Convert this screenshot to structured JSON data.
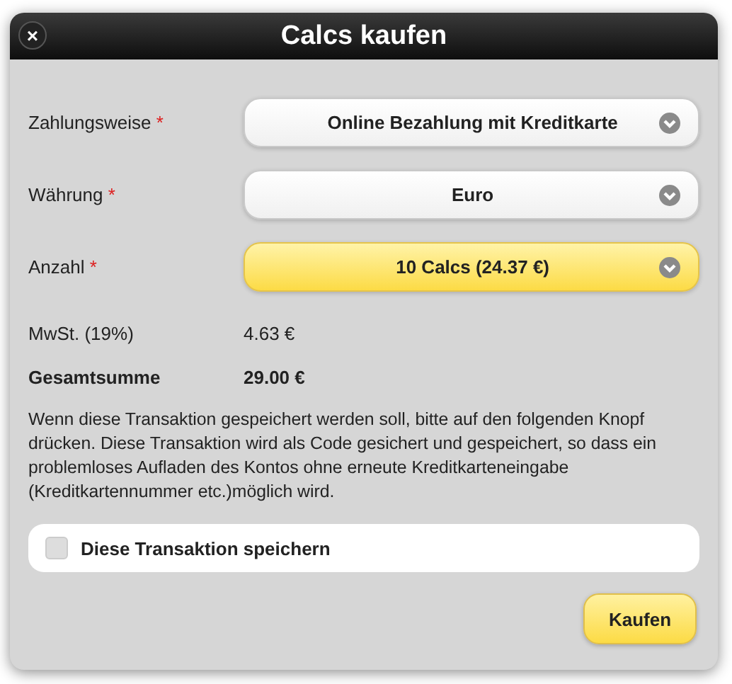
{
  "dialog": {
    "title": "Calcs kaufen",
    "close_icon": "×"
  },
  "fields": [
    {
      "label": "Zahlungsweise",
      "required_mark": "*",
      "value": "Online Bezahlung mit Kreditkarte",
      "active": false
    },
    {
      "label": "Währung",
      "required_mark": "*",
      "value": "Euro",
      "active": false
    },
    {
      "label": "Anzahl",
      "required_mark": "*",
      "value": "10 Calcs (24.37 €)",
      "active": true
    }
  ],
  "summary": [
    {
      "label": "MwSt. (19%)",
      "value": "4.63 €",
      "bold": false
    },
    {
      "label": "Gesamtsumme",
      "value": "29.00 €",
      "bold": true
    }
  ],
  "note": "Wenn diese Transaktion gespeichert werden soll, bitte auf den folgenden Knopf drücken. Diese Transaktion wird als Code gesichert und gespeichert, so dass ein problemloses Aufladen des Kontos ohne erneute Kreditkarteneingabe (Kreditkartennummer etc.)möglich wird.",
  "save_option": {
    "label": "Diese Transaktion speichern",
    "checked": false
  },
  "buttons": [
    {
      "label": "Kaufen"
    }
  ]
}
